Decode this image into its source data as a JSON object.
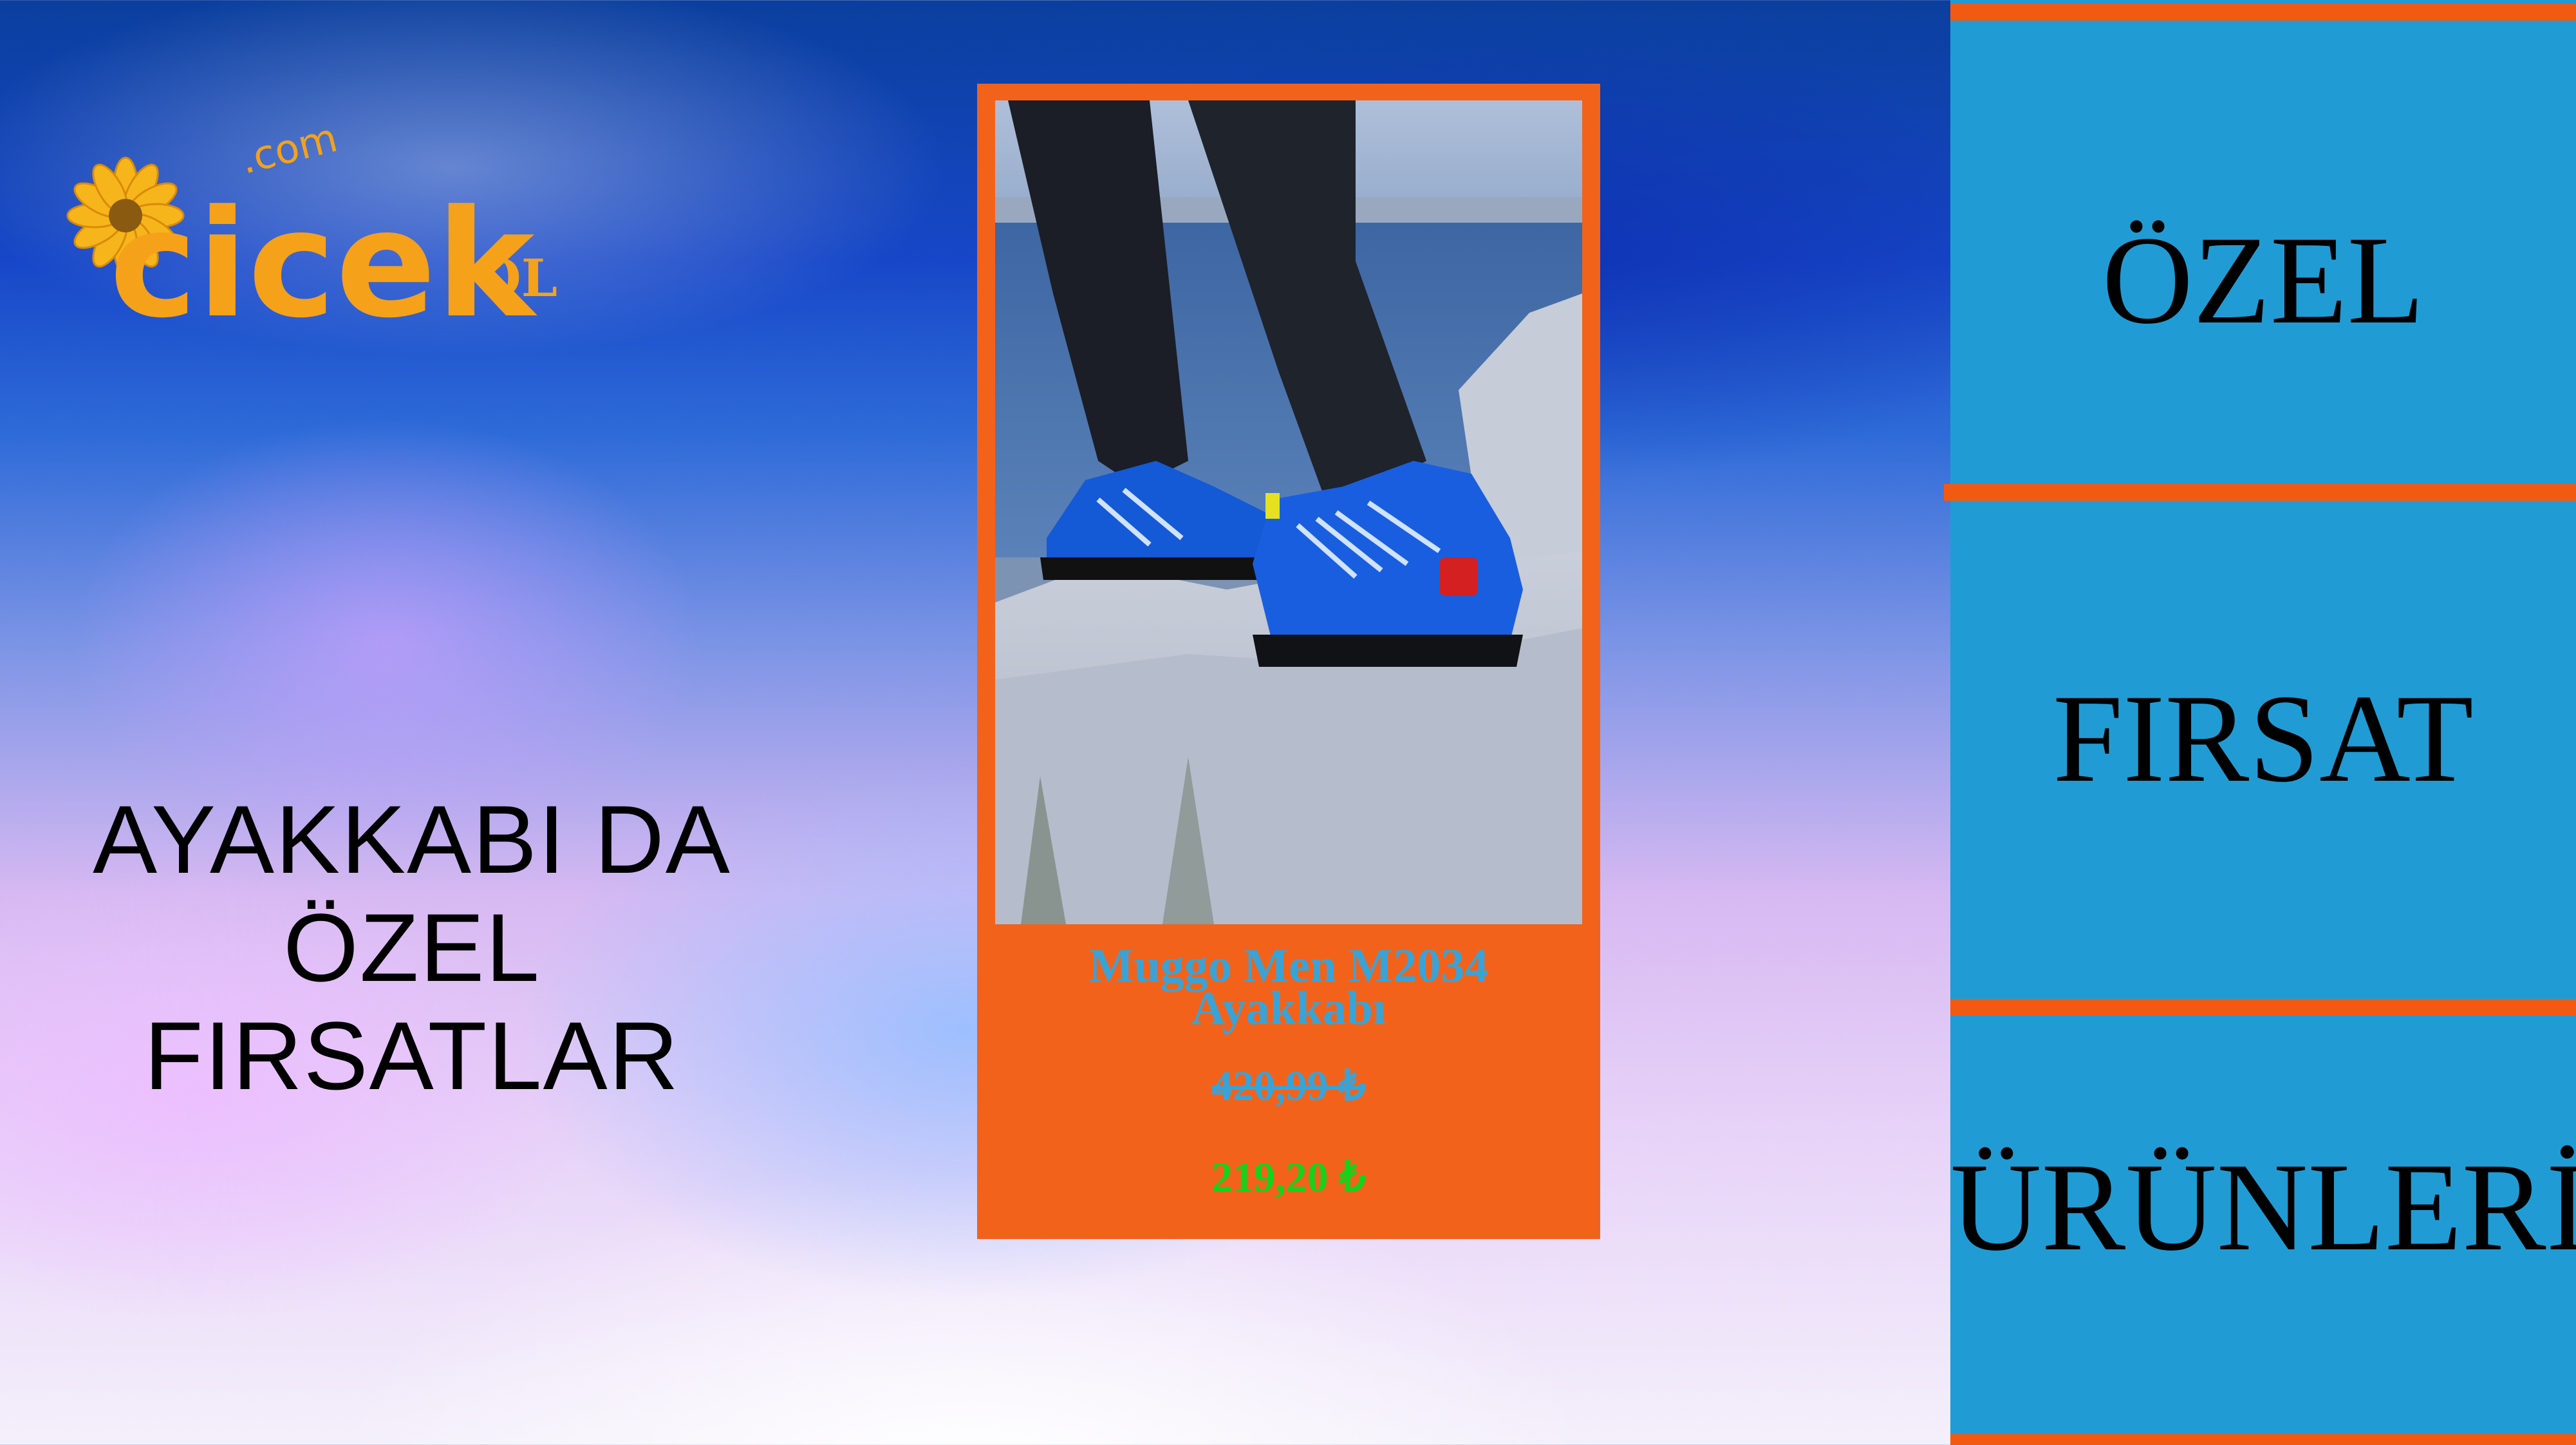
{
  "logo": {
    "wordmark": "cicek",
    "dotcom": ".com",
    "suffix": "OL"
  },
  "headline": {
    "line1": "AYAKKABI DA",
    "line2": "ÖZEL",
    "line3": "FIRSATLAR"
  },
  "product": {
    "name_line1": "Muggo Men M2034",
    "name_line2": "Ayakkabı",
    "old_price": "420,99 ₺",
    "new_price": "219,20 ₺"
  },
  "right_panel": {
    "words": [
      "ÖZEL",
      "FIRSAT",
      "ÜRÜNLERİ"
    ]
  },
  "colors": {
    "card_bg": "#f3621a",
    "panel_bg": "#219bd4",
    "stripe": "#f25a12",
    "name_color": "#3aa3d6",
    "new_price_color": "#16d21a",
    "logo_color": "#f5a11a"
  }
}
